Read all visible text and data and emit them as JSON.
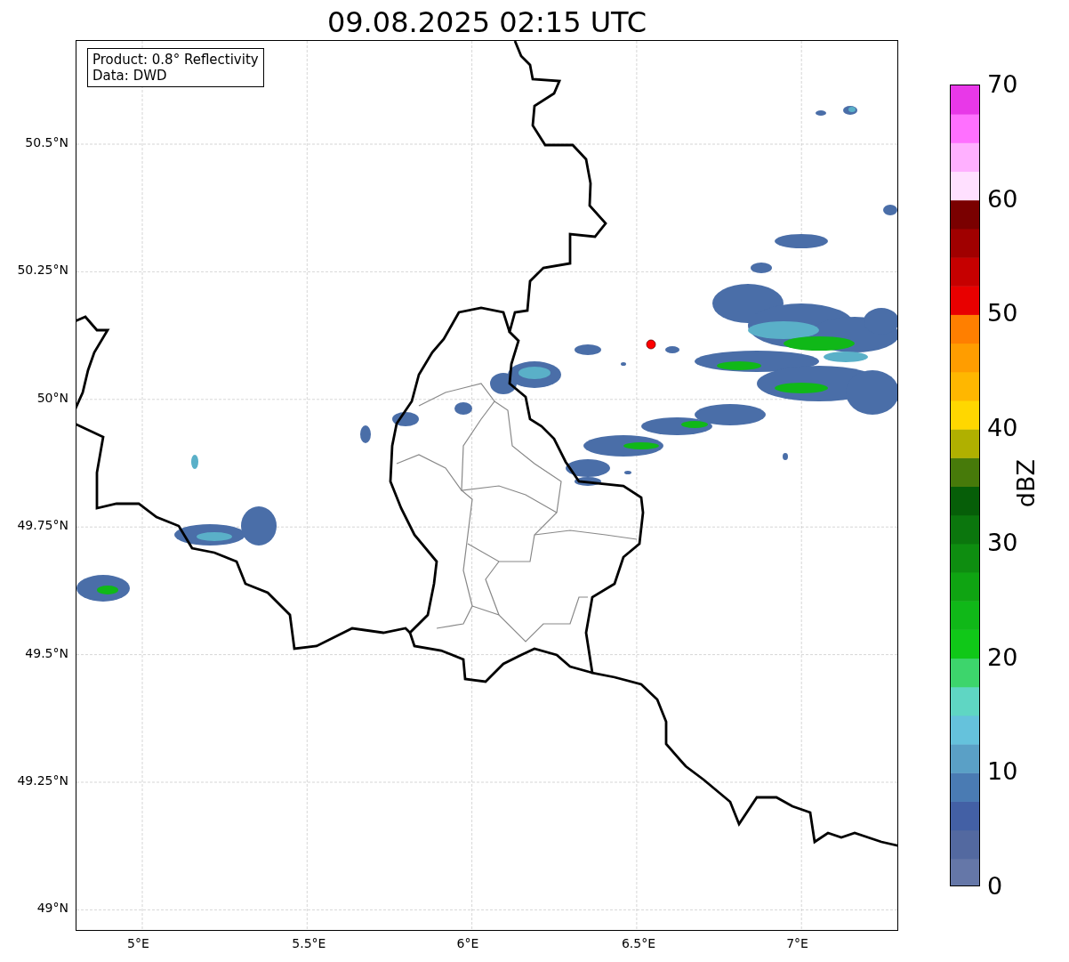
{
  "title": "09.08.2025 02:15 UTC",
  "info_box": {
    "lines": [
      "Product: 0.8° Reflectivity",
      "Data: DWD"
    ]
  },
  "latitude_ticks": [
    "50.5°N",
    "50.25°N",
    "50°N",
    "49.75°N",
    "49.5°N",
    "49.25°N",
    "49°N"
  ],
  "longitude_ticks": [
    "5°E",
    "5.5°E",
    "6°E",
    "6.5°E",
    "7°E"
  ],
  "colorbar": {
    "label": "dBZ",
    "ticks": [
      "70",
      "60",
      "50",
      "40",
      "30",
      "20",
      "10",
      "0"
    ]
  }
}
